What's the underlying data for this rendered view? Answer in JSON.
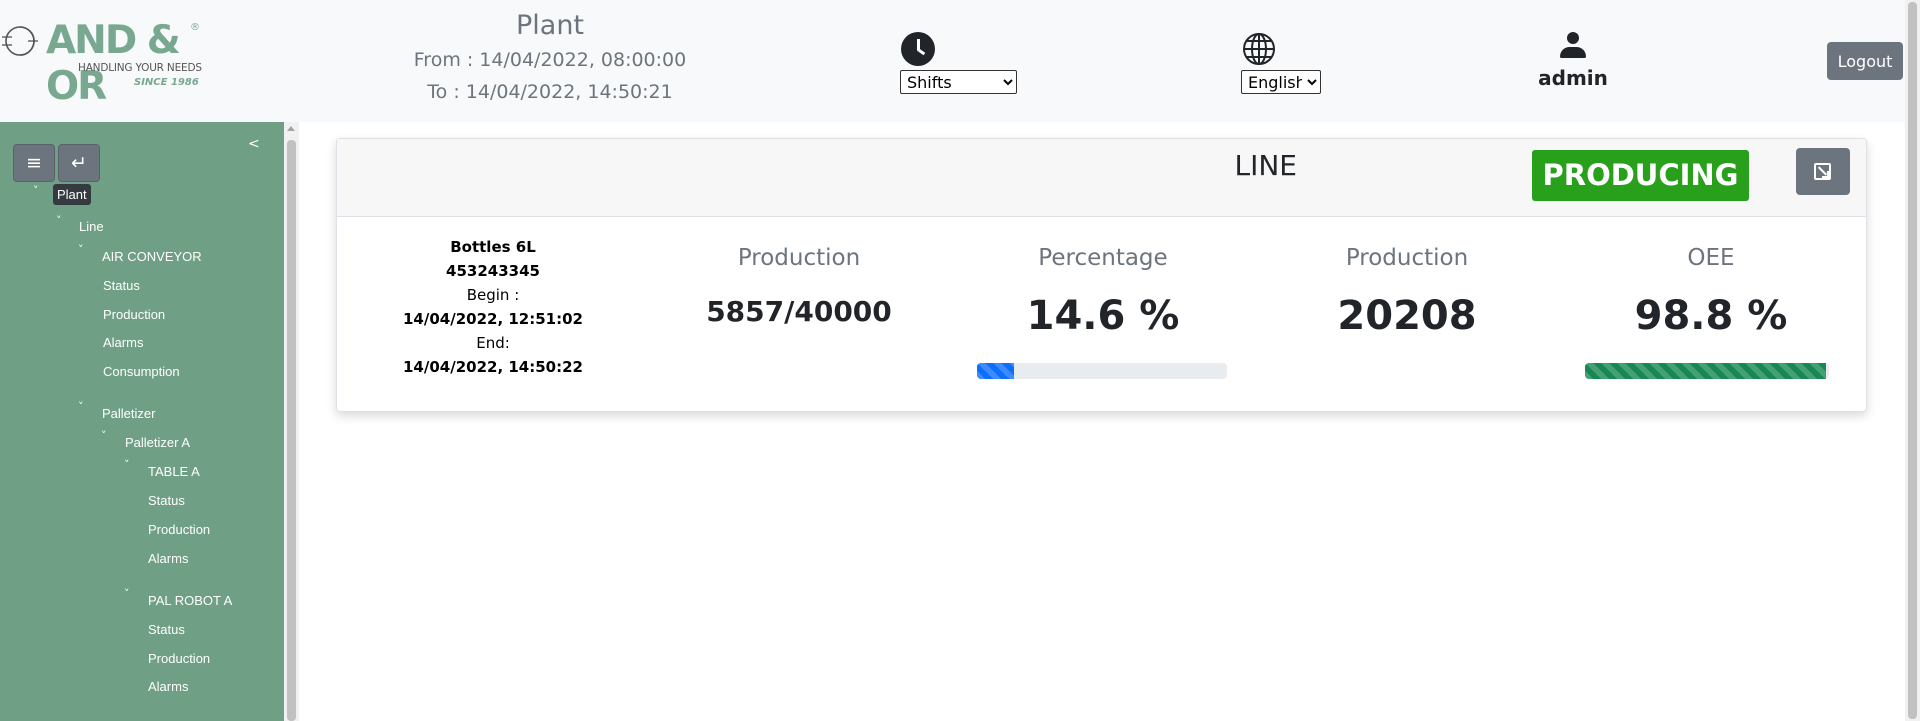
{
  "brand": {
    "logo_text": "AND & OR",
    "logo_reg": "®",
    "tagline": "HANDLING YOUR NEEDS",
    "since": "SINCE 1986",
    "accent_color": "#78a890"
  },
  "header": {
    "title": "Plant",
    "from": "From : 14/04/2022, 08:00:00",
    "to": "To : 14/04/2022, 14:50:21",
    "shift_icon": "clock-icon",
    "shift_selected": "Shifts",
    "language_icon": "globe-icon",
    "language_selected": "English",
    "user_icon": "user-icon",
    "username": "admin",
    "logout_label": "Logout"
  },
  "sidebar": {
    "collapse_label": "<",
    "menu_button": "≡",
    "enter_button": "↵",
    "chevron": "˅",
    "tree": {
      "plant": "Plant",
      "line": "Line",
      "air_conveyor": "AIR CONVEYOR",
      "air_status": "Status",
      "air_production": "Production",
      "air_alarms": "Alarms",
      "air_consumption": "Consumption",
      "palletizer": "Palletizer",
      "palletizer_a": "Palletizer A",
      "table_a": "TABLE A",
      "table_status": "Status",
      "table_production": "Production",
      "table_alarms": "Alarms",
      "pal_robot_a": "PAL ROBOT A",
      "robot_status": "Status",
      "robot_production": "Production",
      "robot_alarms": "Alarms"
    },
    "background_color": "#6f9f85"
  },
  "card": {
    "title": "LINE",
    "status": "PRODUCING",
    "status_color": "#28a01c",
    "expand_icon": "expand-icon",
    "order": {
      "product": "Bottles 6L",
      "order_id": "453243345",
      "begin_label": "Begin :",
      "begin": "14/04/2022, 12:51:02",
      "end_label": "End:",
      "end": "14/04/2022, 14:50:22"
    },
    "metrics": [
      {
        "label": "Production",
        "value": "5857/40000"
      },
      {
        "label": "Percentage",
        "value": "14.6 %",
        "progress": 0.146,
        "bar_color": "#0d6efd"
      },
      {
        "label": "Production",
        "value": "20208"
      },
      {
        "label": "OEE",
        "value": "98.8 %",
        "progress": 0.988,
        "bar_color": "#198754"
      }
    ]
  }
}
